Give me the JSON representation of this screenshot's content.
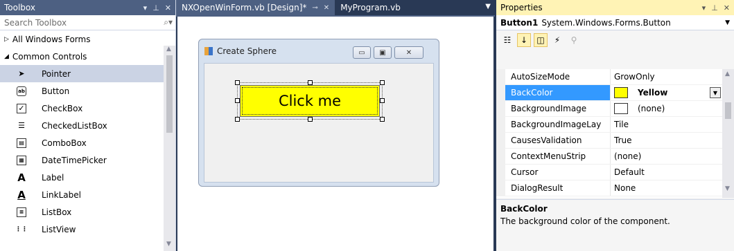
{
  "toolbox": {
    "title": "Toolbox",
    "search_placeholder": "Search Toolbox",
    "categories": [
      {
        "label": "All Windows Forms",
        "expanded": false
      },
      {
        "label": "Common Controls",
        "expanded": true
      }
    ],
    "items": [
      {
        "label": "Pointer",
        "icon": "pointer-icon",
        "selected": true
      },
      {
        "label": "Button",
        "icon": "button-icon"
      },
      {
        "label": "CheckBox",
        "icon": "checkbox-icon"
      },
      {
        "label": "CheckedListBox",
        "icon": "checkedlistbox-icon"
      },
      {
        "label": "ComboBox",
        "icon": "combobox-icon"
      },
      {
        "label": "DateTimePicker",
        "icon": "datetimepicker-icon"
      },
      {
        "label": "Label",
        "icon": "label-icon"
      },
      {
        "label": "LinkLabel",
        "icon": "linklabel-icon"
      },
      {
        "label": "ListBox",
        "icon": "listbox-icon"
      },
      {
        "label": "ListView",
        "icon": "listview-icon"
      }
    ]
  },
  "tabs": [
    {
      "label": "NXOpenWinForm.vb [Design]*",
      "active": true
    },
    {
      "label": "MyProgram.vb",
      "active": false
    }
  ],
  "form": {
    "title": "Create Sphere",
    "button_text": "Click me",
    "button_color": "#ffff00"
  },
  "properties": {
    "title": "Properties",
    "object_name": "Button1",
    "object_type": "System.Windows.Forms.Button",
    "rows": [
      {
        "name": "AutoSizeMode",
        "value": "GrowOnly"
      },
      {
        "name": "BackColor",
        "value": "Yellow",
        "selected": true,
        "swatch": "#ffff00"
      },
      {
        "name": "BackgroundImage",
        "value": "(none)",
        "swatch": "#ffffff"
      },
      {
        "name": "BackgroundImageLay",
        "value": "Tile"
      },
      {
        "name": "CausesValidation",
        "value": "True"
      },
      {
        "name": "ContextMenuStrip",
        "value": "(none)"
      },
      {
        "name": "Cursor",
        "value": "Default"
      },
      {
        "name": "DialogResult",
        "value": "None"
      }
    ],
    "description_title": "BackColor",
    "description_text": "The background color of the component."
  },
  "colors": {
    "panel_title": "#4d6082",
    "ide_background": "#293955",
    "active_panel_title": "#fff3b5",
    "selection": "#3399ff"
  }
}
